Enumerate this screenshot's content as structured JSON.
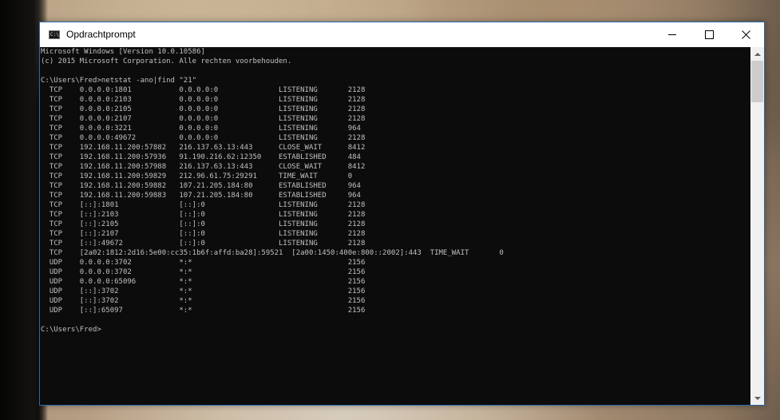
{
  "window": {
    "title": "Opdrachtprompt",
    "icon_label": "C:\\"
  },
  "icons": {
    "app": "command-prompt-icon",
    "minimize": "minimize-icon",
    "maximize": "maximize-icon",
    "close": "close-icon",
    "scroll_up": "scroll-up-arrow-icon",
    "scroll_down": "scroll-down-arrow-icon"
  },
  "colors": {
    "console_background": "#0c0c0c",
    "console_text": "#c0c0c0",
    "title_bar": "#ffffff"
  },
  "console": {
    "lines": [
      "Microsoft Windows [Version 10.0.10586]",
      "(c) 2015 Microsoft Corporation. Alle rechten voorbehouden.",
      "",
      "C:\\Users\\Fred>netstat -ano|find \"21\"",
      "  TCP    0.0.0.0:1801           0.0.0.0:0              LISTENING       2128",
      "  TCP    0.0.0.0:2103           0.0.0.0:0              LISTENING       2128",
      "  TCP    0.0.0.0:2105           0.0.0.0:0              LISTENING       2128",
      "  TCP    0.0.0.0:2107           0.0.0.0:0              LISTENING       2128",
      "  TCP    0.0.0.0:3221           0.0.0.0:0              LISTENING       964",
      "  TCP    0.0.0.0:49672          0.0.0.0:0              LISTENING       2128",
      "  TCP    192.168.11.200:57882   216.137.63.13:443      CLOSE_WAIT      8412",
      "  TCP    192.168.11.200:57936   91.190.216.62:12350    ESTABLISHED     484",
      "  TCP    192.168.11.200:57988   216.137.63.13:443      CLOSE_WAIT      8412",
      "  TCP    192.168.11.200:59829   212.96.61.75:29291     TIME_WAIT       0",
      "  TCP    192.168.11.200:59882   107.21.205.184:80      ESTABLISHED     964",
      "  TCP    192.168.11.200:59883   107.21.205.184:80      ESTABLISHED     964",
      "  TCP    [::]:1801              [::]:0                 LISTENING       2128",
      "  TCP    [::]:2103              [::]:0                 LISTENING       2128",
      "  TCP    [::]:2105              [::]:0                 LISTENING       2128",
      "  TCP    [::]:2107              [::]:0                 LISTENING       2128",
      "  TCP    [::]:49672             [::]:0                 LISTENING       2128",
      "  TCP    [2a02:1812:2d16:5e00:cc35:1b6f:affd:ba28]:59521  [2a00:1450:400e:800::2002]:443  TIME_WAIT       0",
      "  UDP    0.0.0.0:3702           *:*                                    2156",
      "  UDP    0.0.0.0:3702           *:*                                    2156",
      "  UDP    0.0.0.0:65096          *:*                                    2156",
      "  UDP    [::]:3702              *:*                                    2156",
      "  UDP    [::]:3702              *:*                                    2156",
      "  UDP    [::]:65097             *:*                                    2156",
      "",
      "C:\\Users\\Fred>"
    ]
  },
  "scrollbar": {
    "position_fraction": 0.0
  }
}
